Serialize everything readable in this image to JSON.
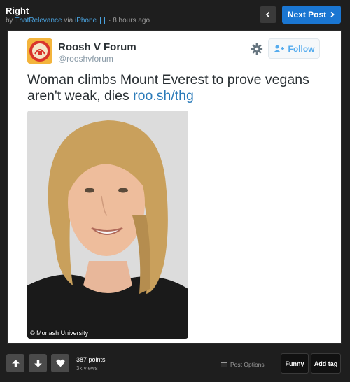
{
  "header": {
    "title": "Right",
    "by_prefix": "by",
    "author": "ThatRelevance",
    "via": "via",
    "platform": "iPhone",
    "time": "· 8 hours ago",
    "next_label": "Next Post"
  },
  "tweet": {
    "account_name": "Roosh V Forum",
    "handle": "@rooshvforum",
    "follow_label": "Follow",
    "text": "Woman climbs Mount Everest to prove vegans aren't weak, dies ",
    "link": "roo.sh/thg",
    "photo_credit": "© Monash University"
  },
  "footer": {
    "points": "387 points",
    "views": "3k views",
    "post_options": "Post Options",
    "funny": "Funny",
    "add_tag": "Add tag"
  },
  "colors": {
    "background": "#1e1e1e",
    "accent_blue": "#1a76d2",
    "link_blue": "#4aa3df",
    "follow_blue": "#55acee"
  },
  "icons": [
    "phone-icon",
    "chevron-left-icon",
    "chevron-right-icon",
    "gear-icon",
    "add-user-icon",
    "arrow-up-icon",
    "arrow-down-icon",
    "heart-icon",
    "list-icon"
  ]
}
